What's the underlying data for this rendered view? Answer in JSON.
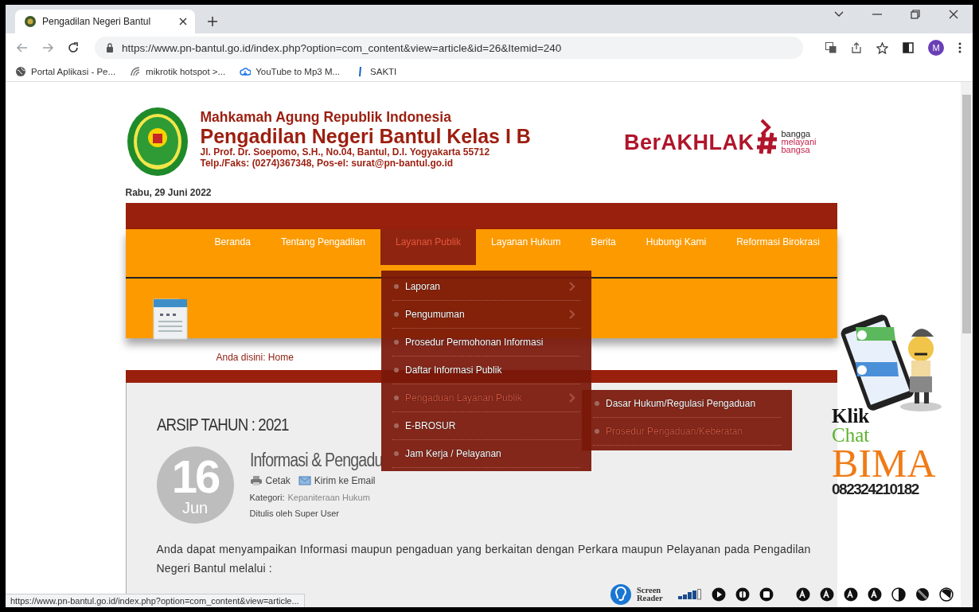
{
  "browser": {
    "tabs": [
      {
        "title": "Pengadilan Negeri Bantul",
        "selected": true
      }
    ],
    "address": "https://www.pn-bantul.go.id/index.php?option=com_content&view=article&id=26&Itemid=240",
    "profile": "M",
    "bookmarks": [
      {
        "label": "Portal Aplikasi - Pe...",
        "kind": "globe"
      },
      {
        "label": "mikrotik hotspot >...",
        "kind": "wave"
      },
      {
        "label": "YouTube to Mp3 M...",
        "kind": "cloud"
      },
      {
        "label": "SAKTI",
        "kind": "bar"
      }
    ]
  },
  "header": {
    "line1": "Mahkamah Agung Republik Indonesia",
    "title": "Pengadilan Negeri Bantul Kelas I B",
    "address": "Jl. Prof. Dr. Soepomo, S.H., No.04, Bantul, D.I. Yogyakarta 55712",
    "contact": "Telp./Faks: (0274)367348, Pos-el: surat@pn-bantul.go.id",
    "brand": "BerAKHLAK",
    "tagline": [
      "bangga",
      "melayani",
      "bangsa"
    ]
  },
  "date": "Rabu, 29 Juni 2022",
  "nav": [
    {
      "label": "Beranda",
      "selected": false
    },
    {
      "label": "Tentang Pengadilan",
      "selected": false
    },
    {
      "label": "Layanan Publik",
      "selected": true
    },
    {
      "label": "Layanan Hukum",
      "selected": false
    },
    {
      "label": "Berita",
      "selected": false
    },
    {
      "label": "Hubungi Kami",
      "selected": false
    },
    {
      "label": "Reformasi Birokrasi",
      "selected": false
    }
  ],
  "dropdown": [
    {
      "label": "Laporan",
      "has_submenu": true,
      "selected": false
    },
    {
      "label": "Pengumuman",
      "has_submenu": true,
      "selected": false
    },
    {
      "label": "Prosedur Permohonan Informasi",
      "has_submenu": false,
      "selected": false
    },
    {
      "label": "Daftar Informasi Publik",
      "has_submenu": false,
      "selected": false
    },
    {
      "label": "Pengaduan Layanan Publik",
      "has_submenu": true,
      "selected": true
    },
    {
      "label": "E-BROSUR",
      "has_submenu": false,
      "selected": false
    },
    {
      "label": "Jam Kerja / Pelayanan",
      "has_submenu": false,
      "selected": false
    }
  ],
  "submenu": [
    {
      "label": "Dasar Hukum/Regulasi Pengaduan",
      "selected": false
    },
    {
      "label": "Prosedur Pengaduan/Keberatan",
      "selected": true
    }
  ],
  "breadcrumb": "Anda disini: Home",
  "article": {
    "archive": "ARSIP TAHUN : 2021",
    "day": "16",
    "month": "Jun",
    "title": "Informasi & Pengadu",
    "print": "Cetak",
    "email": "Kirim ke Email",
    "category_label": "Kategori:",
    "category": "Kepaniteraan Hukum",
    "author": "Ditulis oleh Super User",
    "body": "Anda dapat menyampaikan Informasi maupun pengaduan yang berkaitan dengan Perkara maupun Pelayanan pada Pengadilan Negeri Bantul melalui :"
  },
  "chat_widget": {
    "line1": "Klik",
    "line2": "Chat",
    "line3": "BIMA",
    "phone": "082324210182"
  },
  "screen_reader": {
    "label": "Screen Reader"
  },
  "status_url": "https://www.pn-bantul.go.id/index.php?option=com_content&view=article..."
}
